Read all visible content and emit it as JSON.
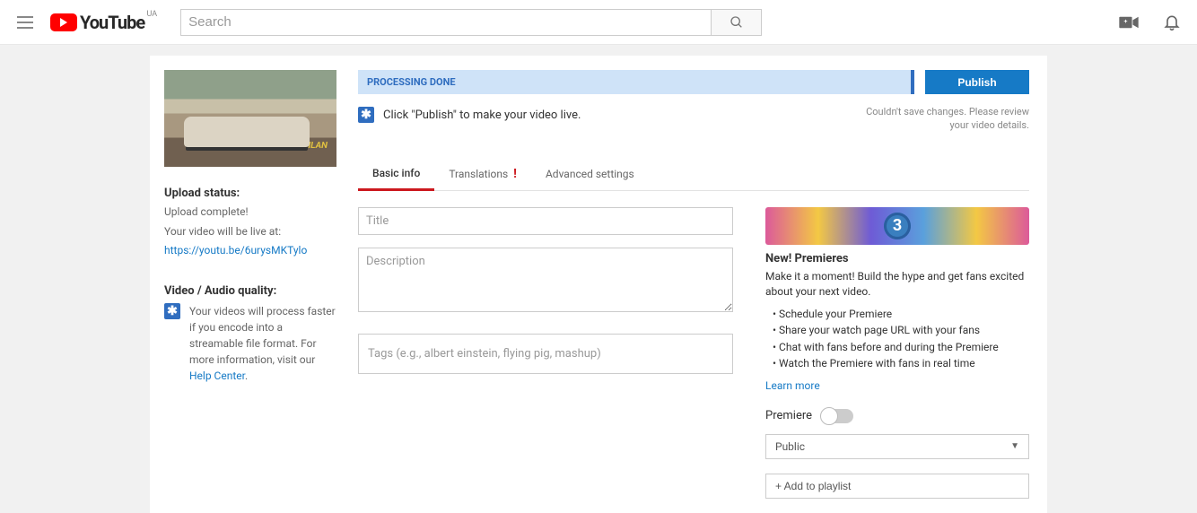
{
  "header": {
    "logo_text": "YouTube",
    "region": "UA",
    "search_placeholder": "Search"
  },
  "sidebar": {
    "upload_status_h": "Upload status:",
    "upload_status_v": "Upload complete!",
    "live_at_label": "Your video will be live at:",
    "live_url": "https://youtu.be/6urysMKTylo",
    "quality_h": "Video / Audio quality:",
    "quality_text": "Your videos will process faster if you encode into a streamable file format. For more information, visit our ",
    "help_link": "Help Center",
    "thumb_tag": "@HAMEDGILAN"
  },
  "status": {
    "bar_text": "PROCESSING DONE",
    "publish_btn": "Publish",
    "info_text": "Click \"Publish\" to make your video live.",
    "error_text": "Couldn't save changes. Please review your video details."
  },
  "tabs": {
    "basic": "Basic info",
    "translations": "Translations",
    "advanced": "Advanced settings"
  },
  "form": {
    "title_placeholder": "Title",
    "desc_placeholder": "Description",
    "tags_placeholder": "Tags (e.g., albert einstein, flying pig, mashup)"
  },
  "premiere": {
    "badge_num": "3",
    "heading": "New! Premieres",
    "body": "Make it a moment! Build the hype and get fans excited about your next video.",
    "bullets": [
      "Schedule your Premiere",
      "Share your watch page URL with your fans",
      "Chat with fans before and during the Premiere",
      "Watch the Premiere with fans in real time"
    ],
    "learn_more": "Learn more",
    "toggle_label": "Premiere",
    "visibility": "Public",
    "playlist_btn": "+ Add to playlist"
  }
}
